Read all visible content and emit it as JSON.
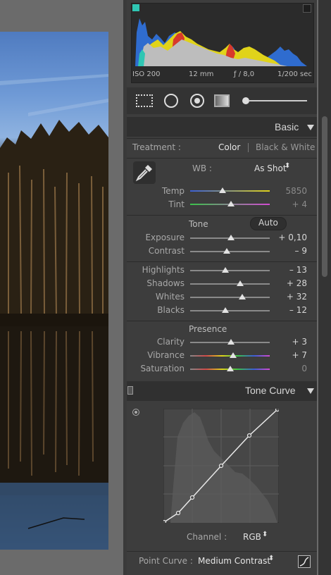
{
  "histogram": {
    "iso": "ISO 200",
    "focal": "12 mm",
    "aperture": "ƒ / 8,0",
    "shutter": "1/200 sec"
  },
  "basic": {
    "title": "Basic",
    "treatment_label": "Treatment :",
    "treatment_color": "Color",
    "treatment_bw": "Black & White",
    "wb_label": "WB :",
    "wb_value": "As Shot",
    "tone_title": "Tone",
    "auto_label": "Auto",
    "presence_title": "Presence",
    "temp": {
      "label": "Temp",
      "value": "5850",
      "pos": 0.36
    },
    "tint": {
      "label": "Tint",
      "value": "+ 4",
      "pos": 0.52
    },
    "exposure": {
      "label": "Exposure",
      "value": "+ 0,10",
      "pos": 0.51
    },
    "contrast": {
      "label": "Contrast",
      "value": "– 9",
      "pos": 0.46
    },
    "highlights": {
      "label": "Highlights",
      "value": "– 13",
      "pos": 0.44
    },
    "shadows": {
      "label": "Shadows",
      "value": "+ 28",
      "pos": 0.63
    },
    "whites": {
      "label": "Whites",
      "value": "+ 32",
      "pos": 0.66
    },
    "blacks": {
      "label": "Blacks",
      "value": "– 12",
      "pos": 0.44
    },
    "clarity": {
      "label": "Clarity",
      "value": "+ 3",
      "pos": 0.51
    },
    "vibrance": {
      "label": "Vibrance",
      "value": "+ 7",
      "pos": 0.54
    },
    "saturation": {
      "label": "Saturation",
      "value": "0",
      "pos": 0.5
    }
  },
  "tone_curve": {
    "title": "Tone Curve",
    "channel_label": "Channel :",
    "channel_value": "RGB",
    "point_curve_label": "Point Curve :",
    "point_curve_value": "Medium Contrast"
  },
  "colors": {
    "accent_teal": "#2fc6b3",
    "panel_bg": "#3d3d3d"
  }
}
